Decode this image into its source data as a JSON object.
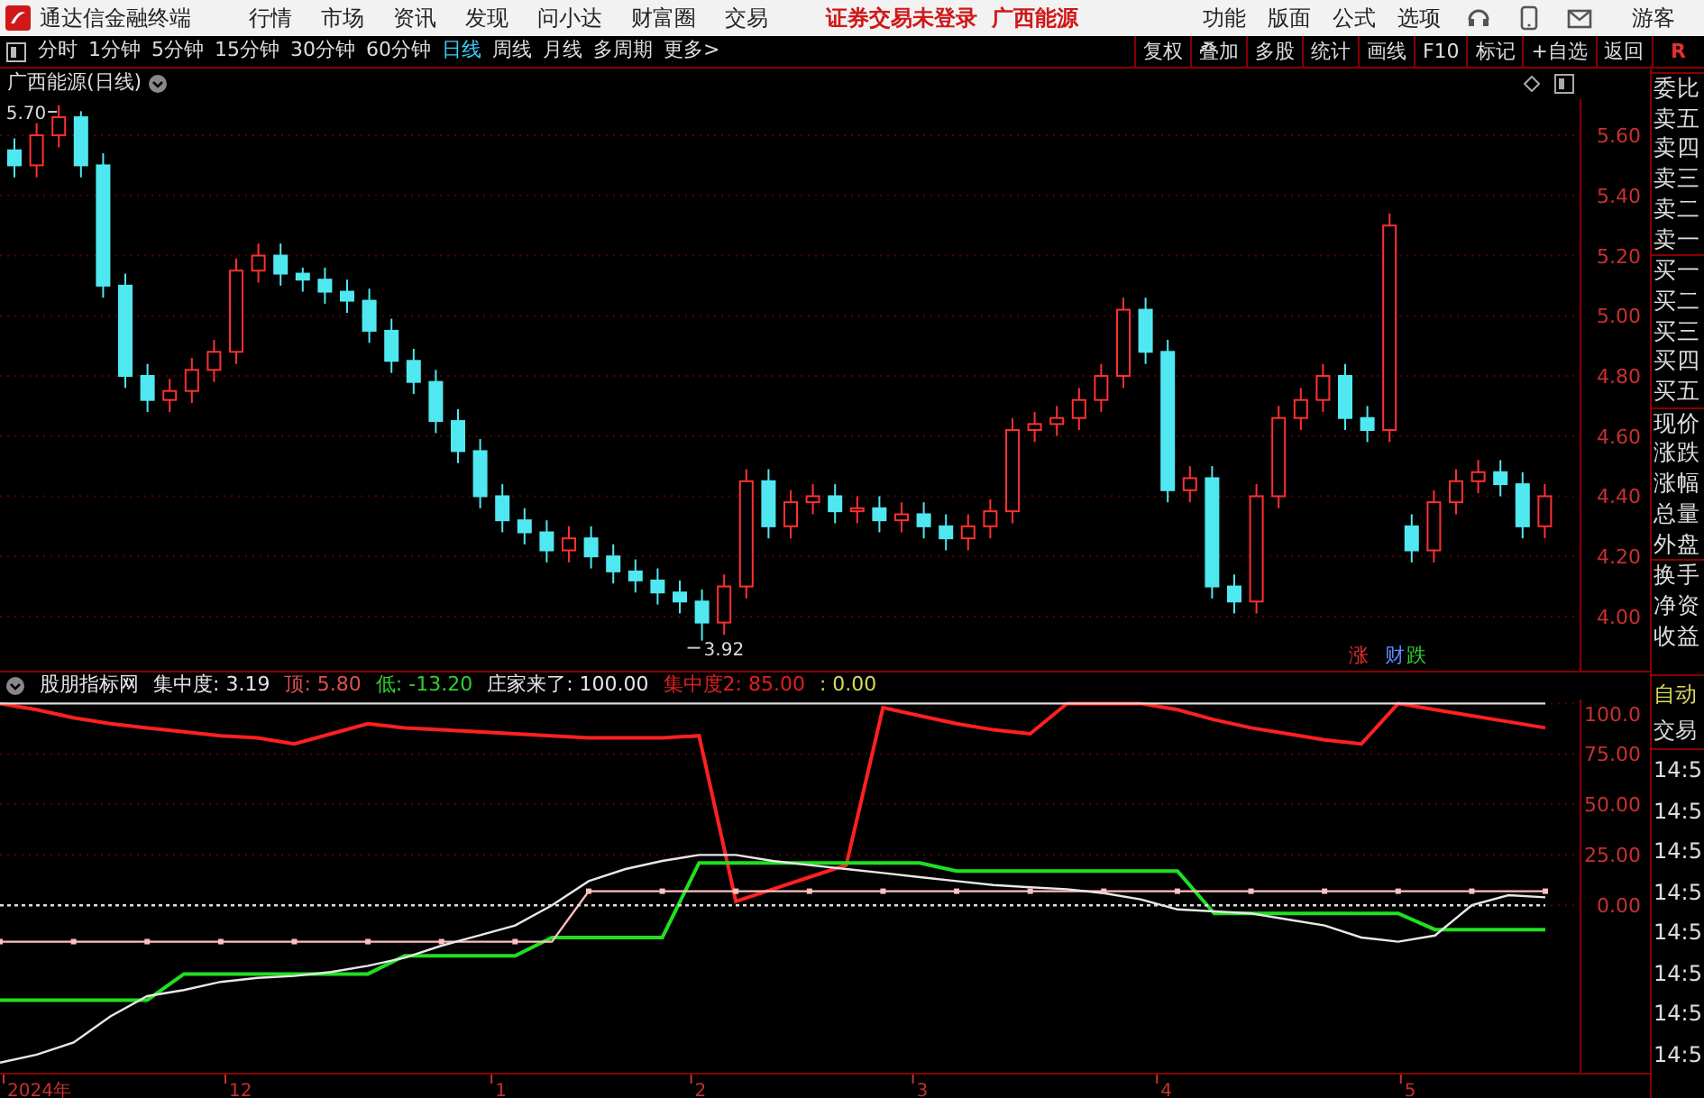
{
  "app": {
    "title": "通达信金融终端",
    "menu": [
      "行情",
      "市场",
      "资讯",
      "发现",
      "问小达",
      "财富圈",
      "交易"
    ],
    "login_notice": "证券交易未登录",
    "stock_name": "广西能源",
    "right_menu": [
      "功能",
      "版面",
      "公式",
      "选项"
    ],
    "user": "游客"
  },
  "periods": [
    {
      "label": "分时",
      "selected": false
    },
    {
      "label": "1分钟",
      "selected": false
    },
    {
      "label": "5分钟",
      "selected": false
    },
    {
      "label": "15分钟",
      "selected": false
    },
    {
      "label": "30分钟",
      "selected": false
    },
    {
      "label": "60分钟",
      "selected": false
    },
    {
      "label": "日线",
      "selected": true
    },
    {
      "label": "周线",
      "selected": false
    },
    {
      "label": "月线",
      "selected": false
    },
    {
      "label": "多周期",
      "selected": false
    },
    {
      "label": "更多>",
      "selected": false
    }
  ],
  "tools": [
    "复权",
    "叠加",
    "多股",
    "统计",
    "画线",
    "F10",
    "标记",
    "+自选",
    "返回"
  ],
  "tools_end": "R",
  "chart_title": "广西能源(日线)",
  "main_chart": {
    "chart_data": {
      "type": "candlestick",
      "grid": true,
      "ylim": [
        3.82,
        5.72
      ],
      "yticks": [
        {
          "value": 4.0,
          "label": "4.00"
        },
        {
          "value": 4.2,
          "label": "4.20"
        },
        {
          "value": 4.4,
          "label": "4.40"
        },
        {
          "value": 4.6,
          "label": "4.60"
        },
        {
          "value": 4.8,
          "label": "4.80"
        },
        {
          "value": 5.0,
          "label": "5.00"
        },
        {
          "value": 5.2,
          "label": "5.20"
        },
        {
          "value": 5.4,
          "label": "5.40"
        },
        {
          "value": 5.6,
          "label": "5.60"
        }
      ],
      "ohlc": [
        [
          5.55,
          5.59,
          5.46,
          5.5
        ],
        [
          5.5,
          5.64,
          5.46,
          5.6
        ],
        [
          5.6,
          5.7,
          5.56,
          5.66
        ],
        [
          5.66,
          5.68,
          5.46,
          5.5
        ],
        [
          5.5,
          5.54,
          5.06,
          5.1
        ],
        [
          5.1,
          5.14,
          4.76,
          4.8
        ],
        [
          4.8,
          4.84,
          4.68,
          4.72
        ],
        [
          4.72,
          4.79,
          4.68,
          4.75
        ],
        [
          4.75,
          4.86,
          4.71,
          4.82
        ],
        [
          4.82,
          4.92,
          4.78,
          4.88
        ],
        [
          4.88,
          5.19,
          4.84,
          5.15
        ],
        [
          5.15,
          5.24,
          5.11,
          5.2
        ],
        [
          5.2,
          5.24,
          5.1,
          5.14
        ],
        [
          5.14,
          5.16,
          5.08,
          5.12
        ],
        [
          5.12,
          5.16,
          5.04,
          5.08
        ],
        [
          5.08,
          5.12,
          5.01,
          5.05
        ],
        [
          5.05,
          5.09,
          4.91,
          4.95
        ],
        [
          4.95,
          4.99,
          4.81,
          4.85
        ],
        [
          4.85,
          4.89,
          4.74,
          4.78
        ],
        [
          4.78,
          4.82,
          4.61,
          4.65
        ],
        [
          4.65,
          4.69,
          4.51,
          4.55
        ],
        [
          4.55,
          4.59,
          4.36,
          4.4
        ],
        [
          4.4,
          4.44,
          4.28,
          4.32
        ],
        [
          4.32,
          4.36,
          4.24,
          4.28
        ],
        [
          4.28,
          4.32,
          4.18,
          4.22
        ],
        [
          4.22,
          4.3,
          4.18,
          4.26
        ],
        [
          4.26,
          4.3,
          4.16,
          4.2
        ],
        [
          4.2,
          4.24,
          4.11,
          4.15
        ],
        [
          4.15,
          4.19,
          4.08,
          4.12
        ],
        [
          4.12,
          4.16,
          4.04,
          4.08
        ],
        [
          4.08,
          4.12,
          4.01,
          4.05
        ],
        [
          4.05,
          4.09,
          3.92,
          3.98
        ],
        [
          3.98,
          4.14,
          3.94,
          4.1
        ],
        [
          4.1,
          4.49,
          4.06,
          4.45
        ],
        [
          4.45,
          4.49,
          4.26,
          4.3
        ],
        [
          4.3,
          4.42,
          4.26,
          4.38
        ],
        [
          4.38,
          4.44,
          4.34,
          4.4
        ],
        [
          4.4,
          4.44,
          4.31,
          4.35
        ],
        [
          4.35,
          4.4,
          4.31,
          4.36
        ],
        [
          4.36,
          4.4,
          4.28,
          4.32
        ],
        [
          4.32,
          4.38,
          4.28,
          4.34
        ],
        [
          4.34,
          4.38,
          4.26,
          4.3
        ],
        [
          4.3,
          4.34,
          4.22,
          4.26
        ],
        [
          4.26,
          4.34,
          4.22,
          4.3
        ],
        [
          4.3,
          4.39,
          4.26,
          4.35
        ],
        [
          4.35,
          4.66,
          4.31,
          4.62
        ],
        [
          4.62,
          4.68,
          4.58,
          4.64
        ],
        [
          4.64,
          4.7,
          4.6,
          4.66
        ],
        [
          4.66,
          4.76,
          4.62,
          4.72
        ],
        [
          4.72,
          4.84,
          4.68,
          4.8
        ],
        [
          4.8,
          5.06,
          4.76,
          5.02
        ],
        [
          5.02,
          5.06,
          4.84,
          4.88
        ],
        [
          4.88,
          4.92,
          4.38,
          4.42
        ],
        [
          4.42,
          4.5,
          4.38,
          4.46
        ],
        [
          4.46,
          4.5,
          4.06,
          4.1
        ],
        [
          4.1,
          4.14,
          4.01,
          4.05
        ],
        [
          4.05,
          4.44,
          4.01,
          4.4
        ],
        [
          4.4,
          4.7,
          4.36,
          4.66
        ],
        [
          4.66,
          4.76,
          4.62,
          4.72
        ],
        [
          4.72,
          4.84,
          4.68,
          4.8
        ],
        [
          4.8,
          4.84,
          4.62,
          4.66
        ],
        [
          4.66,
          4.7,
          4.58,
          4.62
        ],
        [
          4.62,
          5.34,
          4.58,
          5.3
        ],
        [
          4.3,
          4.34,
          4.18,
          4.22
        ],
        [
          4.22,
          4.42,
          4.18,
          4.38
        ],
        [
          4.38,
          4.49,
          4.34,
          4.45
        ],
        [
          4.45,
          4.52,
          4.41,
          4.48
        ],
        [
          4.48,
          4.52,
          4.4,
          4.44
        ],
        [
          4.44,
          4.48,
          4.26,
          4.3
        ],
        [
          4.3,
          4.44,
          4.26,
          4.4
        ]
      ],
      "annotations": [
        "5.70",
        "3.92"
      ]
    },
    "date_axis": [
      "2024年",
      "12",
      "1",
      "2",
      "3",
      "4",
      "5"
    ],
    "signal_labels": [
      {
        "text": "涨",
        "color": "#e03030"
      },
      {
        "text": "财",
        "color": "#5a8cff"
      },
      {
        "text": "跌",
        "color": "#30d030"
      }
    ]
  },
  "indicator": {
    "name": "股朋指标网",
    "readouts": [
      {
        "text": "集中度: 3.19",
        "color": "#e6e6e6"
      },
      {
        "text": "顶: 5.80",
        "color": "#e05050"
      },
      {
        "text": "低: -13.20",
        "color": "#30d030"
      },
      {
        "text": "庄家来了: 100.00",
        "color": "#e6e6e6"
      },
      {
        "text": "集中度2: 85.00",
        "color": "#e02020"
      },
      {
        "text": ": 0.00",
        "color": "#d8d860"
      }
    ],
    "chart_data": {
      "type": "line",
      "grid": true,
      "ylim": [
        -83,
        102
      ],
      "yticks": [
        {
          "value": 0,
          "label": "0.00"
        },
        {
          "value": 25,
          "label": "25.00"
        },
        {
          "value": 50,
          "label": "50.00"
        },
        {
          "value": 75,
          "label": "75.00"
        },
        {
          "value": 100,
          "label": "100.0"
        }
      ],
      "series": [
        {
          "color": "#ff2020",
          "values": [
            100,
            97,
            93,
            90,
            88,
            86,
            84,
            83,
            80,
            85,
            90,
            88,
            87,
            86,
            85,
            84,
            83,
            83,
            83,
            84,
            2,
            8,
            14,
            20,
            98,
            94,
            90,
            87,
            85,
            100,
            100,
            100,
            97,
            92,
            88,
            85,
            82,
            80,
            100,
            97,
            94,
            91,
            88
          ]
        },
        {
          "color": "#20e020",
          "values": [
            -47,
            -47,
            -47,
            -47,
            -47,
            -34,
            -34,
            -34,
            -34,
            -34,
            -34,
            -25,
            -25,
            -25,
            -25,
            -16,
            -16,
            -16,
            -16,
            21,
            21,
            21,
            21,
            21,
            21,
            21,
            17,
            17,
            17,
            17,
            17,
            17,
            17,
            -4,
            -4,
            -4,
            -4,
            -4,
            -4,
            -12,
            -12,
            -12,
            -12
          ]
        },
        {
          "color": "#ffc0c0",
          "values": [
            -18,
            -18,
            -18,
            -18,
            -18,
            -18,
            -18,
            -18,
            -18,
            -18,
            -18,
            -18,
            -18,
            -18,
            -18,
            -18,
            7,
            7,
            7,
            7,
            7,
            7,
            7,
            7,
            7,
            7,
            7,
            7,
            7,
            7,
            7,
            7,
            7,
            7,
            7,
            7,
            7,
            7,
            7,
            7,
            7,
            7,
            7
          ]
        },
        {
          "color": "#e8e8e8",
          "values": [
            -78,
            -74,
            -68,
            -55,
            -45,
            -42,
            -38,
            -36,
            -35,
            -33,
            -30,
            -26,
            -20,
            -15,
            -10,
            0,
            12,
            18,
            22,
            25,
            25,
            22,
            20,
            18,
            16,
            14,
            12,
            10,
            9,
            8,
            6,
            3,
            -2,
            -3,
            -4,
            -7,
            -10,
            -16,
            -18,
            -15,
            0,
            5,
            4
          ]
        },
        {
          "color": "#dddddd",
          "line_style": "dashed",
          "values": [
            0,
            0,
            0,
            0,
            0,
            0,
            0,
            0,
            0,
            0,
            0,
            0,
            0,
            0,
            0,
            0,
            0,
            0,
            0,
            0,
            0,
            0,
            0,
            0,
            0,
            0,
            0,
            0,
            0,
            0,
            0,
            0,
            0,
            0,
            0,
            0,
            0,
            0,
            0,
            0,
            0,
            0,
            0
          ]
        },
        {
          "color": "#dddddd",
          "values": [
            100,
            100,
            100,
            100,
            100,
            100,
            100,
            100,
            100,
            100,
            100,
            100,
            100,
            100,
            100,
            100,
            100,
            100,
            100,
            100,
            100,
            100,
            100,
            100,
            100,
            100,
            100,
            100,
            100,
            100,
            100,
            100,
            100,
            100,
            100,
            100,
            100,
            100,
            100,
            100,
            100,
            100,
            100
          ]
        }
      ]
    }
  },
  "quote_panel": [
    "委比",
    "卖五",
    "卖四",
    "卖三",
    "卖二",
    "卖一",
    "买一",
    "买二",
    "买三",
    "买四",
    "买五",
    "现价",
    "涨跌",
    "涨幅",
    "总量",
    "外盘",
    "换手",
    "净资",
    "收益"
  ],
  "trade_panel": {
    "header": [
      "自动",
      "交易"
    ],
    "times": [
      "14:5",
      "14:5",
      "14:5",
      "14:5",
      "14:5",
      "14:5",
      "14:5",
      "14:5"
    ]
  }
}
